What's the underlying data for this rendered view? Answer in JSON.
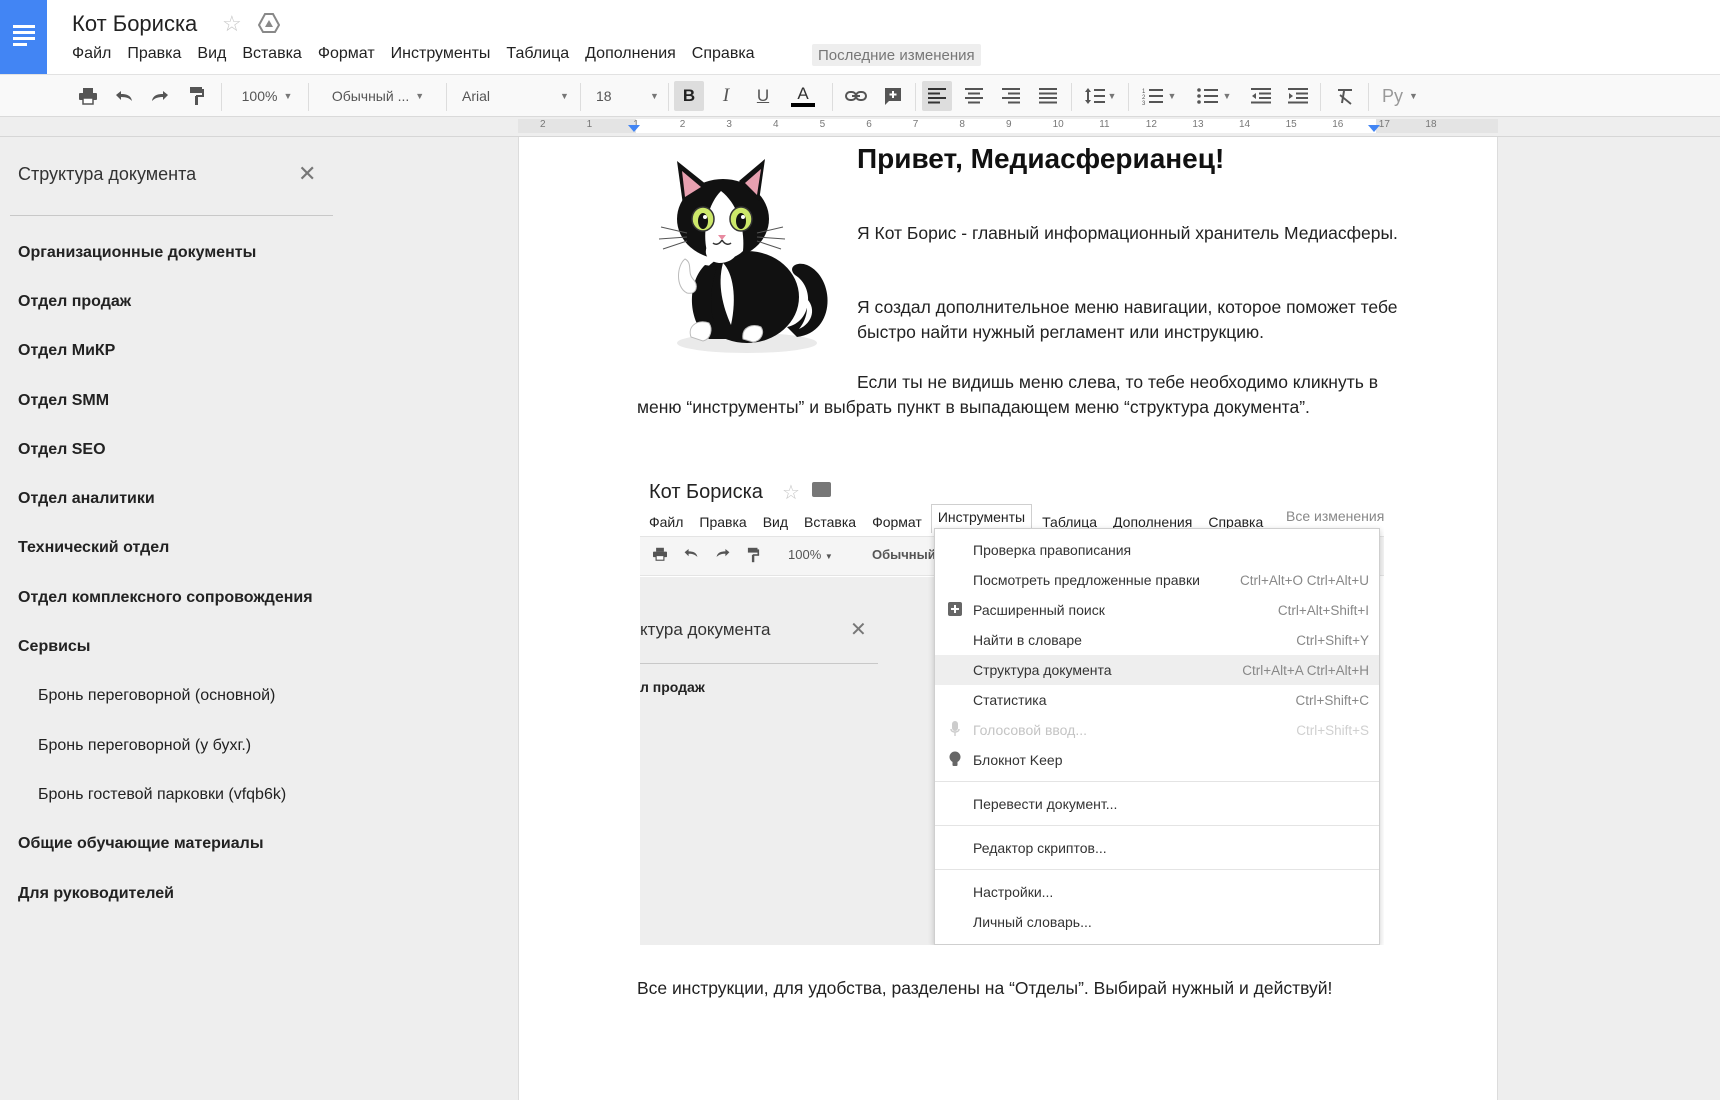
{
  "app": {
    "accent": "#4285f4"
  },
  "doc": {
    "title": "Кот Бориска",
    "last_edit": "Последние изменения"
  },
  "menubar": [
    "Файл",
    "Правка",
    "Вид",
    "Вставка",
    "Формат",
    "Инструменты",
    "Таблица",
    "Дополнения",
    "Справка"
  ],
  "toolbar": {
    "zoom": "100%",
    "style": "Обычный ...",
    "font": "Arial",
    "size": "18",
    "bold": "B",
    "italic": "I",
    "underline": "U",
    "text_color": "A",
    "input_tools": "Ру",
    "text_color_value": "#000000"
  },
  "ruler": {
    "ticks": [
      "2",
      "1",
      "1",
      "2",
      "3",
      "4",
      "5",
      "6",
      "7",
      "8",
      "9",
      "10",
      "11",
      "12",
      "13",
      "14",
      "15",
      "16",
      "17",
      "18"
    ]
  },
  "outline": {
    "title": "Структура документа",
    "items": [
      {
        "label": "Организационные документы",
        "level": 1
      },
      {
        "label": "Отдел продаж",
        "level": 1
      },
      {
        "label": "Отдел МиКР",
        "level": 1
      },
      {
        "label": "Отдел SMM",
        "level": 1
      },
      {
        "label": "Отдел SEO",
        "level": 1
      },
      {
        "label": "Отдел аналитики",
        "level": 1
      },
      {
        "label": "Технический отдел",
        "level": 1
      },
      {
        "label": "Отдел комплексного сопровождения",
        "level": 1
      },
      {
        "label": "Сервисы",
        "level": 1
      },
      {
        "label": "Бронь переговорной (основной)",
        "level": 2
      },
      {
        "label": "Бронь переговорной (у бухг.)",
        "level": 2
      },
      {
        "label": "Бронь гостевой парковки (vfqb6k)",
        "level": 2
      },
      {
        "label": "Общие обучающие материалы",
        "level": 1
      },
      {
        "label": "Для руководителей",
        "level": 1
      }
    ]
  },
  "content": {
    "heading": "Привет, Медиасферианец!",
    "p1": "Я Кот Борис - главный информационный хранитель Медиасферы.",
    "p2": "Я создал дополнительное меню навигации, которое поможет тебе быстро найти нужный регламент или инструкцию.",
    "p3": "Если ты не видишь меню слева, то тебе необходимо кликнуть в меню “инструменты” и выбрать пункт в выпадающем меню “структура документа”.",
    "p4": "Все инструкции, для удобства, разделены на “Отделы”. Выбирай нужный и действуй!"
  },
  "embedded": {
    "title": "Кот Бориска",
    "menubar": [
      "Файл",
      "Правка",
      "Вид",
      "Вставка",
      "Формат",
      "Инструменты",
      "Таблица",
      "Дополнения",
      "Справка"
    ],
    "last_edit": "Все изменения",
    "zoom": "100%",
    "style": "Обычный",
    "outline_title": "ктура документа",
    "outline_item": "л продаж",
    "menu": [
      {
        "label": "Проверка правописания",
        "shortcut": "",
        "icon": ""
      },
      {
        "label": "Посмотреть предложенные правки",
        "shortcut": "Ctrl+Alt+O Ctrl+Alt+U",
        "icon": ""
      },
      {
        "label": "Расширенный поиск",
        "shortcut": "Ctrl+Alt+Shift+I",
        "icon": "plus-box-icon"
      },
      {
        "label": "Найти в словаре",
        "shortcut": "Ctrl+Shift+Y",
        "icon": ""
      },
      {
        "label": "Структура документа",
        "shortcut": "Ctrl+Alt+A Ctrl+Alt+H",
        "icon": "",
        "highlight": true
      },
      {
        "label": "Статистика",
        "shortcut": "Ctrl+Shift+C",
        "icon": ""
      },
      {
        "label": "Голосовой ввод...",
        "shortcut": "Ctrl+Shift+S",
        "icon": "mic-icon",
        "disabled": true
      },
      {
        "label": "Блокнот Keep",
        "shortcut": "",
        "icon": "bulb-icon"
      },
      {
        "label": "Перевести документ...",
        "shortcut": "",
        "icon": ""
      },
      {
        "label": "Редактор скриптов...",
        "shortcut": "",
        "icon": ""
      },
      {
        "label": "Настройки...",
        "shortcut": "",
        "icon": ""
      },
      {
        "label": "Личный словарь...",
        "shortcut": "",
        "icon": ""
      }
    ]
  }
}
